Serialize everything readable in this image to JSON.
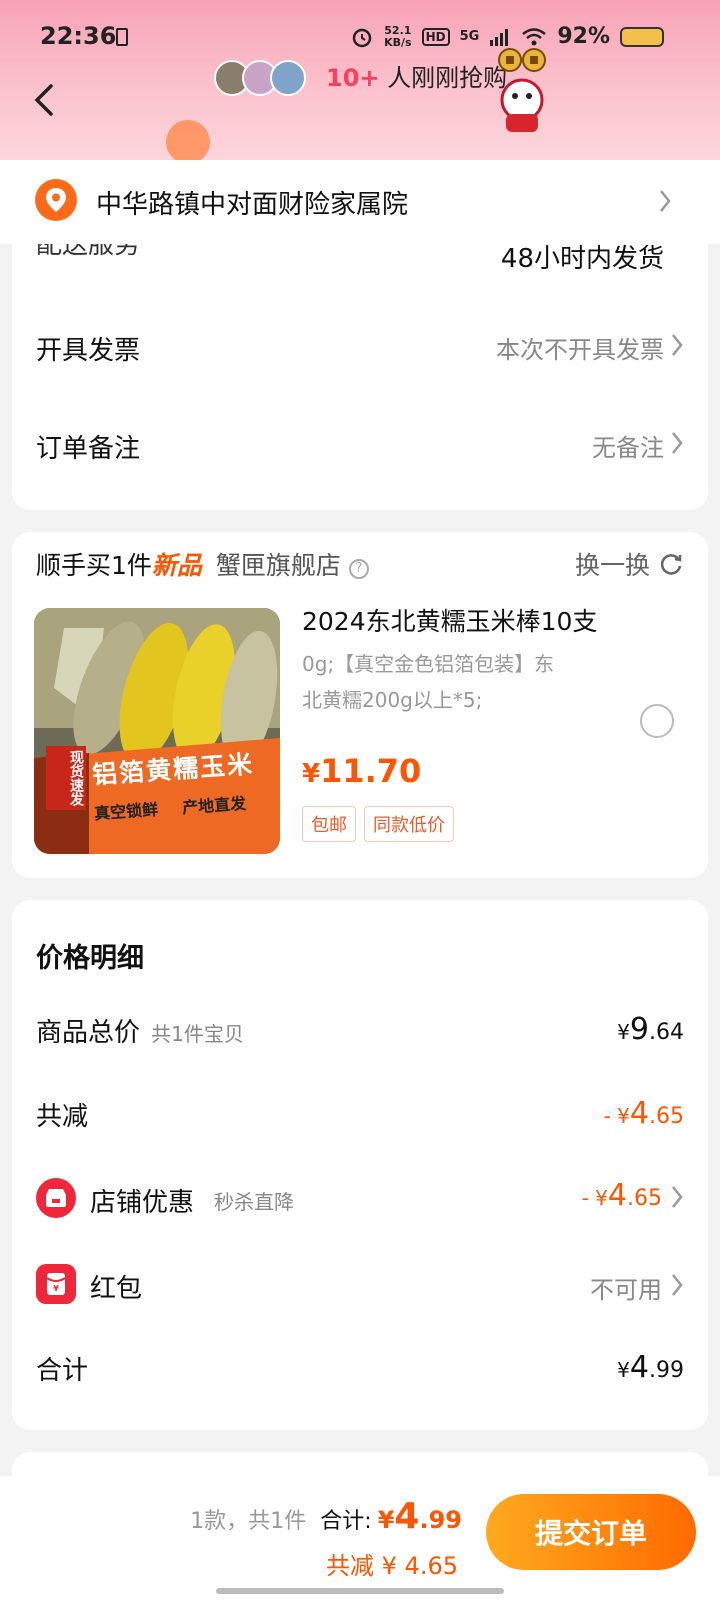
{
  "status_bar": {
    "time": "22:36",
    "net_speed_top": "52.1",
    "net_speed_bottom": "KB/s",
    "hd": "HD",
    "signal": "5G",
    "battery": "92%"
  },
  "header": {
    "buyers_count": "10+",
    "buyers_text": "人刚刚抢购"
  },
  "address": {
    "text": "中华路镇中对面财险家属院"
  },
  "order_card": {
    "delivery_label": "配送服务",
    "delivery_value": "48小时内发货",
    "invoice_label": "开具发票",
    "invoice_value": "本次不开具发票",
    "note_label": "订单备注",
    "note_value": "无备注"
  },
  "addon": {
    "title_prefix": "顺手买1件",
    "title_new": "新品",
    "shop": "蟹匣旗舰店",
    "swap": "换一换",
    "product_title": "2024东北黄糯玉米棒10支",
    "product_desc_1": "0g;【真空金色铝箔包装】东",
    "product_desc_2": "北黄糯200g以上*5;",
    "price_symbol": "¥",
    "price": "11.70",
    "tag_1": "包邮",
    "tag_2": "同款低价",
    "image_text": {
      "side_banner": "现货速发",
      "main": "铝箔黄糯玉米",
      "sub_left": "真空锁鲜",
      "sub_right": "产地直发"
    }
  },
  "price_detail": {
    "title": "价格明细",
    "total_label": "商品总价",
    "total_sub": "共1件宝贝",
    "total_value_int": "9",
    "total_value_dec": ".64",
    "discount_label": "共减",
    "discount_value_prefix": "- ¥",
    "discount_value_int": "4",
    "discount_value_dec": ".65",
    "shop_coupon_label": "店铺优惠",
    "shop_coupon_sub": "秒杀直降",
    "redpack_label": "红包",
    "redpack_value": "不可用",
    "sum_label": "合计",
    "sum_value_int": "4",
    "sum_value_dec": ".99",
    "currency": "¥"
  },
  "bottom": {
    "count_text": "1款，共1件",
    "total_label": "合计:",
    "total_symbol": "¥",
    "total_int": "4",
    "total_dec": ".99",
    "save_text": "共减 ¥ 4.65",
    "submit": "提交订单"
  },
  "colors": {
    "accent": "#ff5500",
    "header_pink": "#f7a3b6",
    "pin": "#ff6a1a",
    "coupon_red": "#f0263a"
  }
}
